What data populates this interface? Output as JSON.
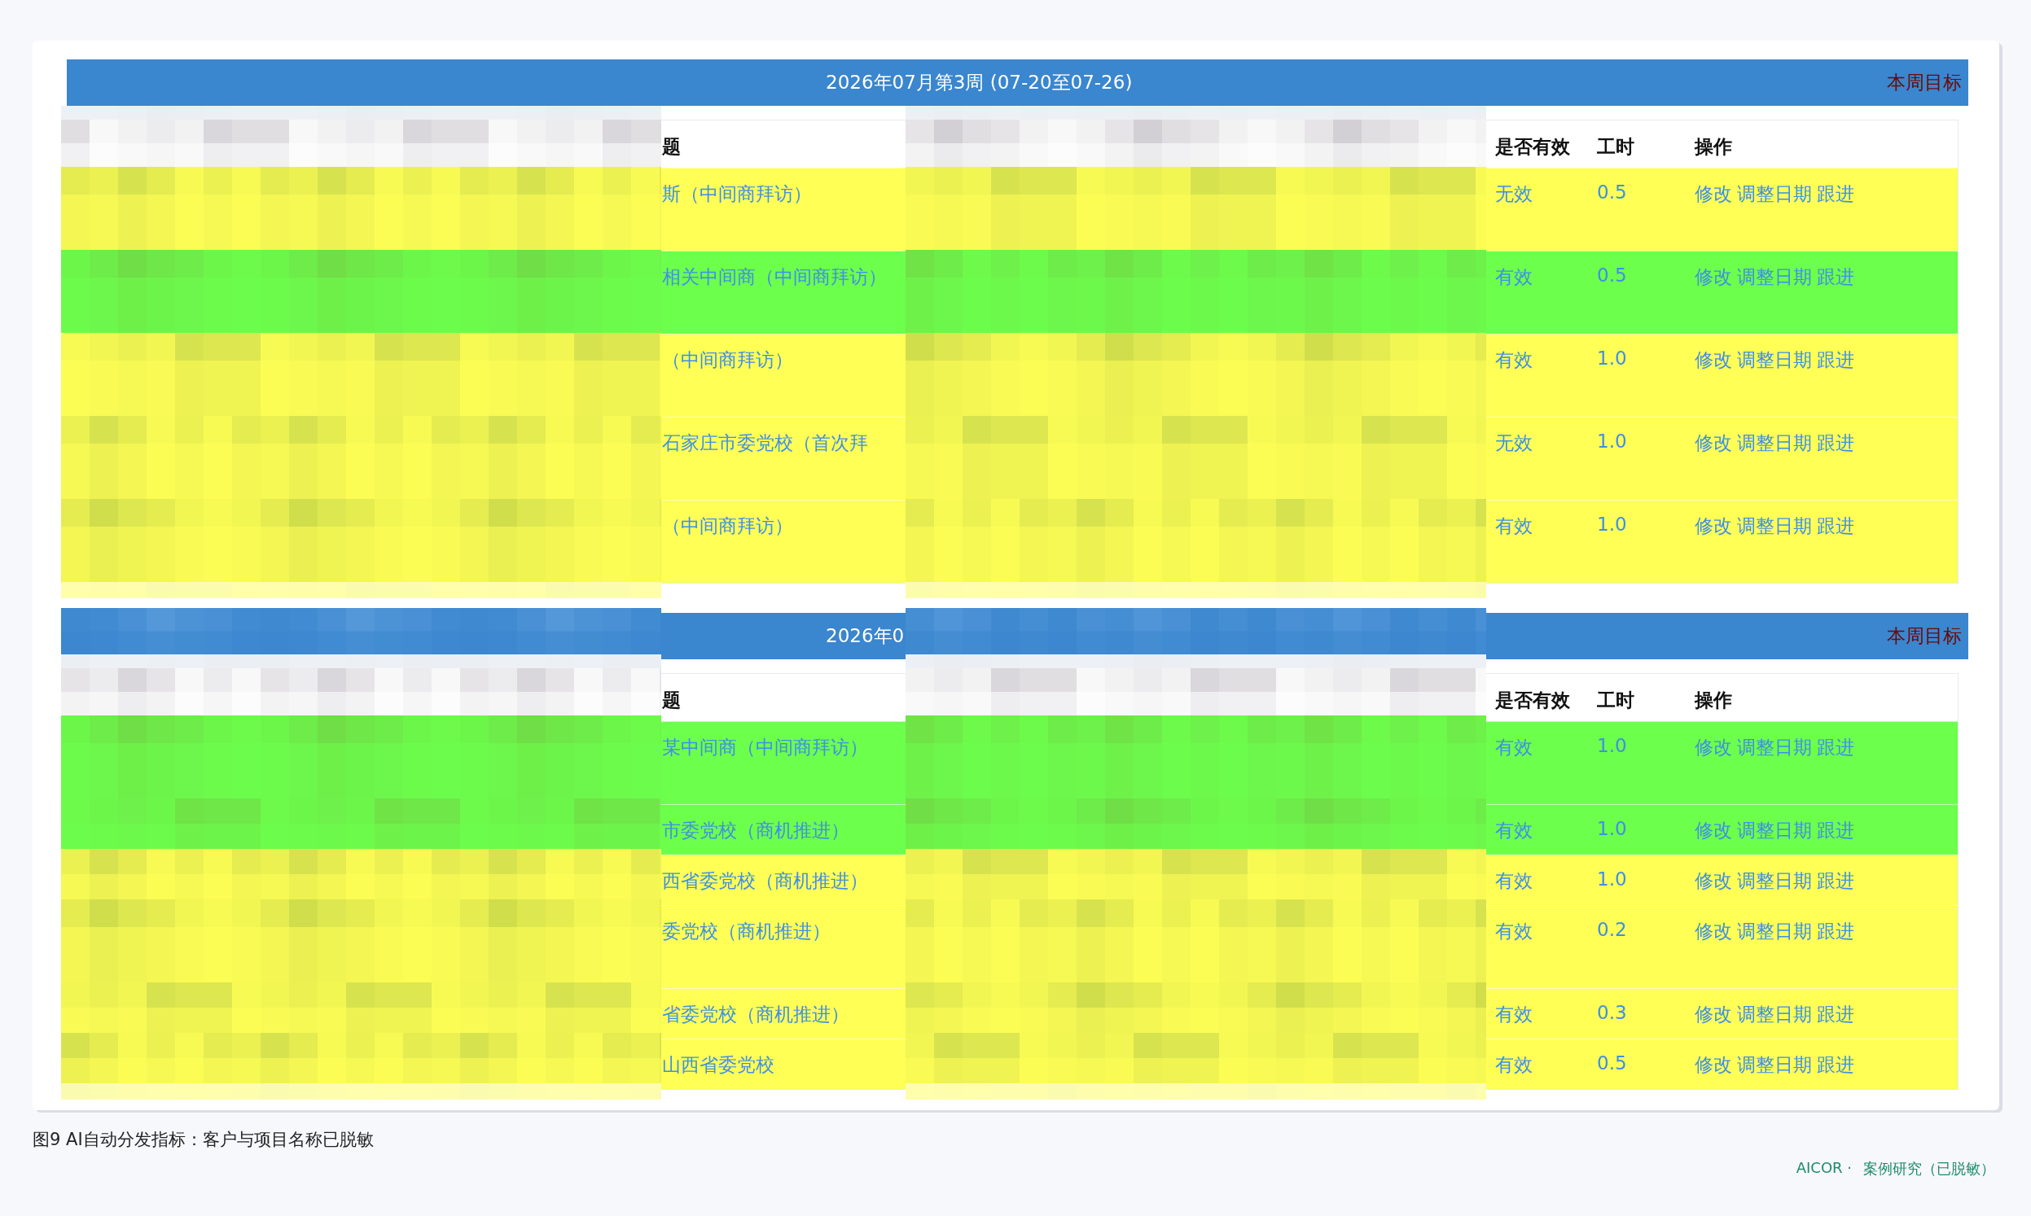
{
  "blocks": [
    {
      "week_title": "2026年07月第3周 (07-20至07-26)",
      "goal": "本周目标",
      "mosaic_over_header": false,
      "columns": [
        "题",
        "是否有效",
        "工时",
        "操作"
      ],
      "rows": [
        {
          "title": "斯（中间商拜访）",
          "valid": "无效",
          "hours": "0.5",
          "actions": [
            "修改",
            "调整日期",
            "跟进"
          ],
          "color": "#ffff55",
          "wrapped": true
        },
        {
          "title": "相关中间商（中间商拜访）",
          "valid": "有效",
          "hours": "0.5",
          "actions": [
            "修改",
            "调整日期",
            "跟进"
          ],
          "color": "#6cff4c",
          "wrapped": true
        },
        {
          "title": "（中间商拜访）",
          "valid": "有效",
          "hours": "1.0",
          "actions": [
            "修改",
            "调整日期",
            "跟进"
          ],
          "color": "#ffff55",
          "wrapped": true
        },
        {
          "title": "石家庄市委党校（首次拜",
          "valid": "无效",
          "hours": "1.0",
          "actions": [
            "修改",
            "调整日期",
            "跟进"
          ],
          "color": "#ffff55",
          "wrapped": true
        },
        {
          "title": "（中间商拜访）",
          "valid": "有效",
          "hours": "1.0",
          "actions": [
            "修改",
            "调整日期",
            "跟进"
          ],
          "color": "#ffff55",
          "wrapped": true
        }
      ]
    },
    {
      "week_title": "2026年0",
      "goal": "本周目标",
      "mosaic_over_header": true,
      "columns": [
        "题",
        "是否有效",
        "工时",
        "操作"
      ],
      "rows": [
        {
          "title": "某中间商（中间商拜访）",
          "valid": "有效",
          "hours": "1.0",
          "actions": [
            "修改",
            "调整日期",
            "跟进"
          ],
          "color": "#6cff4c",
          "wrapped": true
        },
        {
          "title": "市委党校（商机推进）",
          "valid": "有效",
          "hours": "1.0",
          "actions": [
            "修改",
            "调整日期",
            "跟进"
          ],
          "color": "#6cff4c",
          "wrapped": false
        },
        {
          "title": "西省委党校（商机推进）",
          "valid": "有效",
          "hours": "1.0",
          "actions": [
            "修改",
            "调整日期",
            "跟进"
          ],
          "color": "#ffff55",
          "wrapped": false
        },
        {
          "title": "委党校（商机推进）",
          "valid": "有效",
          "hours": "0.2",
          "actions": [
            "修改",
            "调整日期",
            "跟进"
          ],
          "color": "#ffff55",
          "wrapped": true
        },
        {
          "title": "省委党校（商机推进）",
          "valid": "有效",
          "hours": "0.3",
          "actions": [
            "修改",
            "调整日期",
            "跟进"
          ],
          "color": "#ffff55",
          "wrapped": false
        },
        {
          "title": "山西省委党校",
          "valid": "有效",
          "hours": "0.5",
          "actions": [
            "修改",
            "调整日期",
            "跟进"
          ],
          "color": "#ffff55",
          "wrapped": false
        }
      ]
    }
  ],
  "caption": "图9 AI自动分发指标：客户与项目名称已脱敏",
  "footer": {
    "brand": "AICOR ·",
    "note": "案例研究（已脱敏）"
  }
}
